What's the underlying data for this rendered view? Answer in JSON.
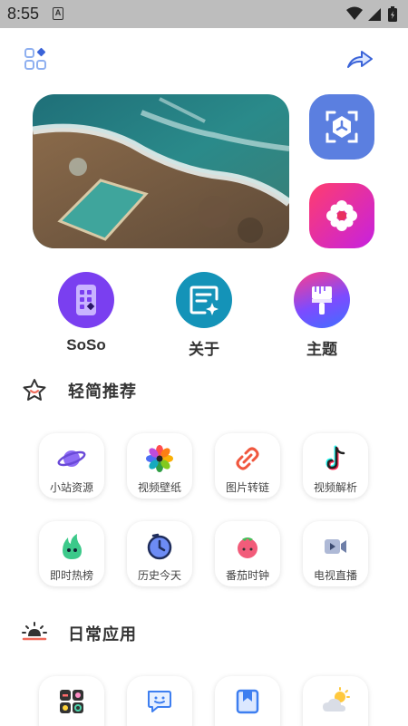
{
  "status_bar": {
    "time": "8:55",
    "badge": "A"
  },
  "features": [
    {
      "label": "SoSo"
    },
    {
      "label": "关于"
    },
    {
      "label": "主题"
    }
  ],
  "sections": {
    "recommend": {
      "title": "轻简推荐",
      "tiles": [
        {
          "label": "小站资源",
          "icon": "planet-icon"
        },
        {
          "label": "视频壁纸",
          "icon": "flower-icon"
        },
        {
          "label": "图片转链",
          "icon": "link-icon"
        },
        {
          "label": "视频解析",
          "icon": "tiktok-icon"
        },
        {
          "label": "即时热榜",
          "icon": "flame-icon"
        },
        {
          "label": "历史今天",
          "icon": "clock-icon"
        },
        {
          "label": "番茄时钟",
          "icon": "tomato-icon"
        },
        {
          "label": "电视直播",
          "icon": "video-camera-icon"
        }
      ]
    },
    "daily": {
      "title": "日常应用",
      "tiles": [
        {
          "label": "",
          "icon": "apps-icon"
        },
        {
          "label": "",
          "icon": "chat-icon"
        },
        {
          "label": "",
          "icon": "bookmark-icon"
        },
        {
          "label": "",
          "icon": "weather-icon"
        }
      ]
    }
  },
  "colors": {
    "status_bar_bg": "#bdbdbd",
    "accent_blue": "#5b7fe0",
    "soso_purple": "#7a3ff0",
    "about_teal": "#1493b8",
    "theme_gradient": [
      "#ff3d8b",
      "#3f6fff"
    ]
  }
}
